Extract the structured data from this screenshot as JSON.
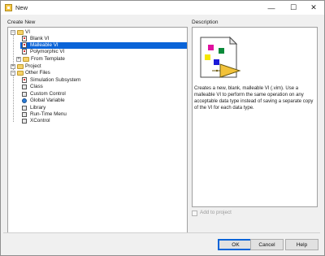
{
  "window": {
    "title": "New"
  },
  "title_controls": {
    "minimize": "—",
    "maximize": "☐",
    "close": "✕"
  },
  "create_new": {
    "label": "Create New",
    "tree": [
      {
        "label": "VI",
        "expander": "−"
      },
      {
        "label": "Blank VI"
      },
      {
        "label": "Malleable VI",
        "selected": true
      },
      {
        "label": "Polymorphic VI"
      },
      {
        "label": "From Template",
        "expander": "+"
      },
      {
        "label": "Project",
        "expander": "+"
      },
      {
        "label": "Other Files",
        "expander": "−"
      },
      {
        "label": "Simulation Subsystem"
      },
      {
        "label": "Class"
      },
      {
        "label": "Custom Control"
      },
      {
        "label": "Global Variable"
      },
      {
        "label": "Library"
      },
      {
        "label": "Run-Time Menu"
      },
      {
        "label": "XControl"
      }
    ]
  },
  "description": {
    "label": "Description",
    "text": "Creates a new, blank, malleable VI (.vim). Use a malleable VI to perform the same operation on any acceptable data type instead of saving a separate copy of the VI for each data type.",
    "preview_colors": [
      "#e0119f",
      "#0a8a3a",
      "#f5e600",
      "#1b1bd8"
    ]
  },
  "add_to_project": {
    "label": "Add to project",
    "checked": false,
    "enabled": false
  },
  "buttons": {
    "ok": "OK",
    "cancel": "Cancel",
    "help": "Help"
  }
}
